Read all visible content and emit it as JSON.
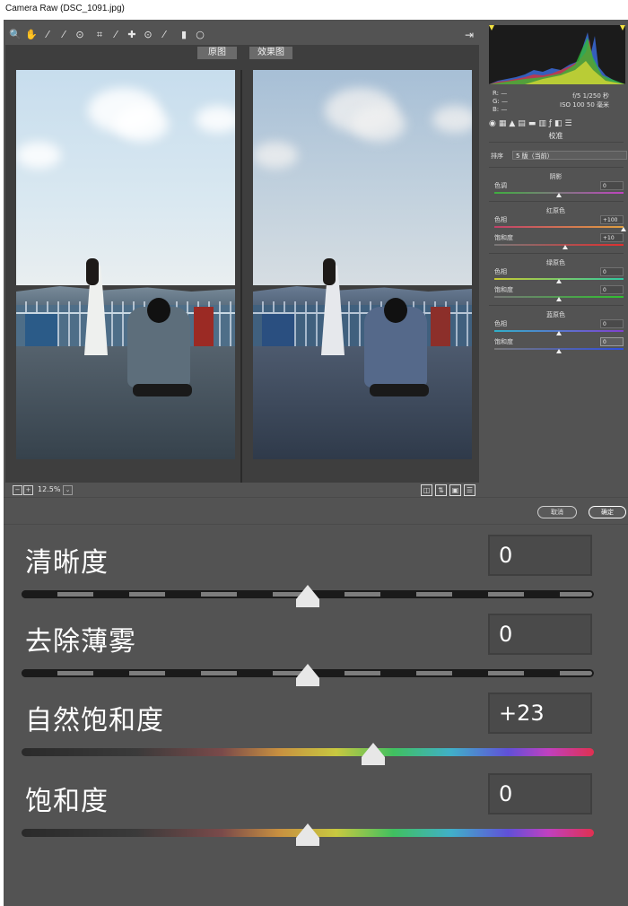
{
  "window": {
    "title": "Camera Raw (DSC_1091.jpg)"
  },
  "toolbar": {
    "tools": [
      {
        "name": "zoom-icon",
        "glyph": "🔍"
      },
      {
        "name": "hand-icon",
        "glyph": "✋"
      },
      {
        "name": "white-balance-icon",
        "glyph": "⁄"
      },
      {
        "name": "color-sampler-icon",
        "glyph": "⁄"
      },
      {
        "name": "targeted-adjustment-icon",
        "glyph": "⊙"
      },
      {
        "name": "crop-icon",
        "glyph": "⌗"
      },
      {
        "name": "straighten-icon",
        "glyph": "⁄"
      },
      {
        "name": "spot-removal-icon",
        "glyph": "✚"
      },
      {
        "name": "red-eye-icon",
        "glyph": "⊙"
      },
      {
        "name": "adjustment-brush-icon",
        "glyph": "⁄"
      },
      {
        "name": "graduated-filter-icon",
        "glyph": "▮"
      },
      {
        "name": "radial-filter-icon",
        "glyph": "○"
      }
    ],
    "exit_glyph": "⇥"
  },
  "preview": {
    "tab_before": "原图",
    "tab_after": "效果图"
  },
  "statusbar": {
    "zoom": "12.5%",
    "minus": "−",
    "plus": "+",
    "dropdown": "⌄"
  },
  "histogram": {
    "rgb_labels": [
      "R:",
      "G:",
      "B:"
    ],
    "rgb_values": [
      "—",
      "—",
      "—"
    ],
    "aperture_shutter": "f/5    1/250 秒",
    "iso_focal": "ISO 100   50 毫米"
  },
  "panel": {
    "title": "校准",
    "blend_label": "排序",
    "blend_value": "5 版（当前）",
    "shadows": {
      "title": "阴影",
      "tint_label": "色调",
      "tint_value": "0",
      "tint_level": 0
    },
    "red_primary": {
      "title": "红原色",
      "hue_label": "色相",
      "hue_value": "+100",
      "hue_level": 100,
      "sat_label": "饱和度",
      "sat_value": "+10",
      "sat_level": 10
    },
    "green_primary": {
      "title": "绿原色",
      "hue_label": "色相",
      "hue_value": "0",
      "hue_level": 0,
      "sat_label": "饱和度",
      "sat_value": "0",
      "sat_level": 0
    },
    "blue_primary": {
      "title": "蓝原色",
      "hue_label": "色相",
      "hue_value": "0",
      "hue_level": 0,
      "sat_label": "饱和度",
      "sat_value": "0",
      "sat_level": 0
    }
  },
  "dialog": {
    "cancel": "取消",
    "ok": "确定"
  },
  "enlarged": [
    {
      "label": "清晰度",
      "value": "0",
      "level": 0,
      "track": "gray"
    },
    {
      "label": "去除薄雾",
      "value": "0",
      "level": 0,
      "track": "gray"
    },
    {
      "label": "自然饱和度",
      "value": "+23",
      "level": 23,
      "track": "rainbow"
    },
    {
      "label": "饱和度",
      "value": "0",
      "level": 0,
      "track": "rainbow"
    }
  ],
  "colors": {
    "app_bg": "#535353",
    "viewport_bg": "#3e3e3e",
    "track_gray": "#1a1a1a",
    "shadow_tint": "linear-gradient(90deg,#3fae3f,#c043c0)",
    "red_hue": "linear-gradient(90deg,#c0406a,#e0a040)",
    "red_sat": "linear-gradient(90deg,#777,#e03030)",
    "green_hue": "linear-gradient(90deg,#c9c930,#30c9a0)",
    "green_sat": "linear-gradient(90deg,#777,#30c030)",
    "blue_hue": "linear-gradient(90deg,#30b0c9,#8040d0)",
    "blue_sat": "linear-gradient(90deg,#777,#3050e0)"
  }
}
